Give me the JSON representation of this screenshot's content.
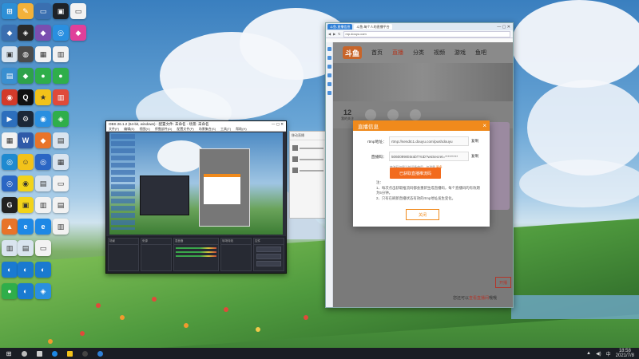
{
  "taskbar": {
    "time": "18:58",
    "date": "2021/7/8",
    "lang": "中"
  },
  "obs": {
    "title": "OBS 26.1.2 (64-bit, windows) - 配置文件: 未命名 - 场景: 未命名",
    "menu": [
      "文件(F)",
      "编辑(E)",
      "视图(V)",
      "停靠部件(D)",
      "配置文件(P)",
      "场景集合(S)",
      "工具(T)",
      "帮助(H)"
    ],
    "docks": [
      "场景",
      "来源",
      "混音器",
      "转场特效",
      "控件"
    ]
  },
  "chat_panel": {
    "title": "移动直播"
  },
  "browser": {
    "tabs": [
      "斗鱼-直播信息",
      "斗鱼-每个人的直播平台"
    ],
    "address": "mp.douyu.com"
  },
  "site": {
    "logo": "斗鱼",
    "nav": [
      "首页",
      "直播",
      "分类",
      "视频",
      "游戏",
      "鱼吧"
    ],
    "active_nav": "直播",
    "stat_num": "12",
    "stat_label": "我的关注",
    "footer_text": "您还可以",
    "footer_link": "查看直播间",
    "footer_suffix": "哦哦",
    "side_button": "开播"
  },
  "modal": {
    "title": "直播信息",
    "close": "×",
    "rtmp_label": "rtmp地址：",
    "rtmp_value": "rtmp://sendtc1.douyu.com/pushdouyu",
    "rtmp_copy": "复制",
    "code_label": "直播码：",
    "code_value": "5060099rE6rabTYoD?wsSecret=*********",
    "code_copy": "复制",
    "hint": "串流码仅限当前设备使用，勿泄露",
    "hint_link": "更多",
    "primary_button": "已获取直播推流码",
    "notes_title": "注：",
    "notes": [
      "1、每次点击获取推流码都会重新生成直播码，每个直播码的有效期为5分钟。",
      "2、只有在刷新直播状态有效的rtmp地址发生变化。"
    ],
    "close_button": "关闭"
  }
}
